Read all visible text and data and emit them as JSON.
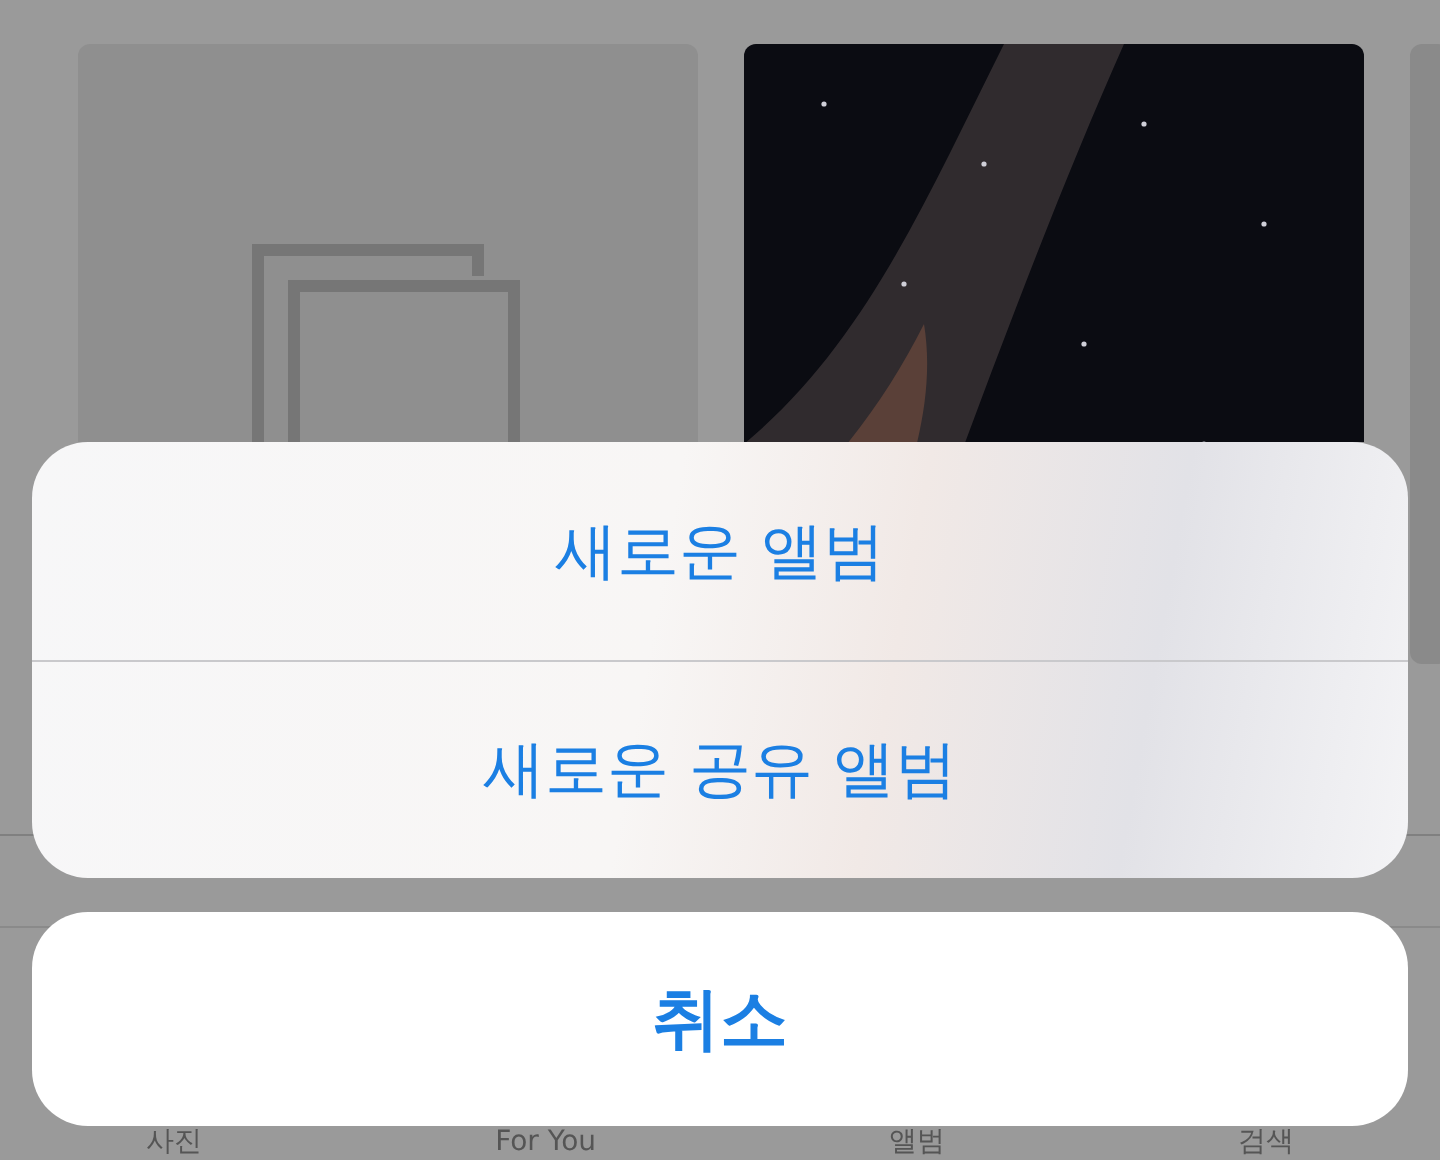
{
  "album_grid": {
    "tiles": [
      {
        "kind": "placeholder"
      },
      {
        "kind": "picture"
      }
    ]
  },
  "tab_bar": {
    "tabs": [
      {
        "label": "사진"
      },
      {
        "label": "For You"
      },
      {
        "label": "앨범"
      },
      {
        "label": "검색"
      }
    ]
  },
  "action_sheet": {
    "actions": [
      "새로운 앨범",
      "새로운 공유 앨범"
    ],
    "cancel": "취소"
  }
}
